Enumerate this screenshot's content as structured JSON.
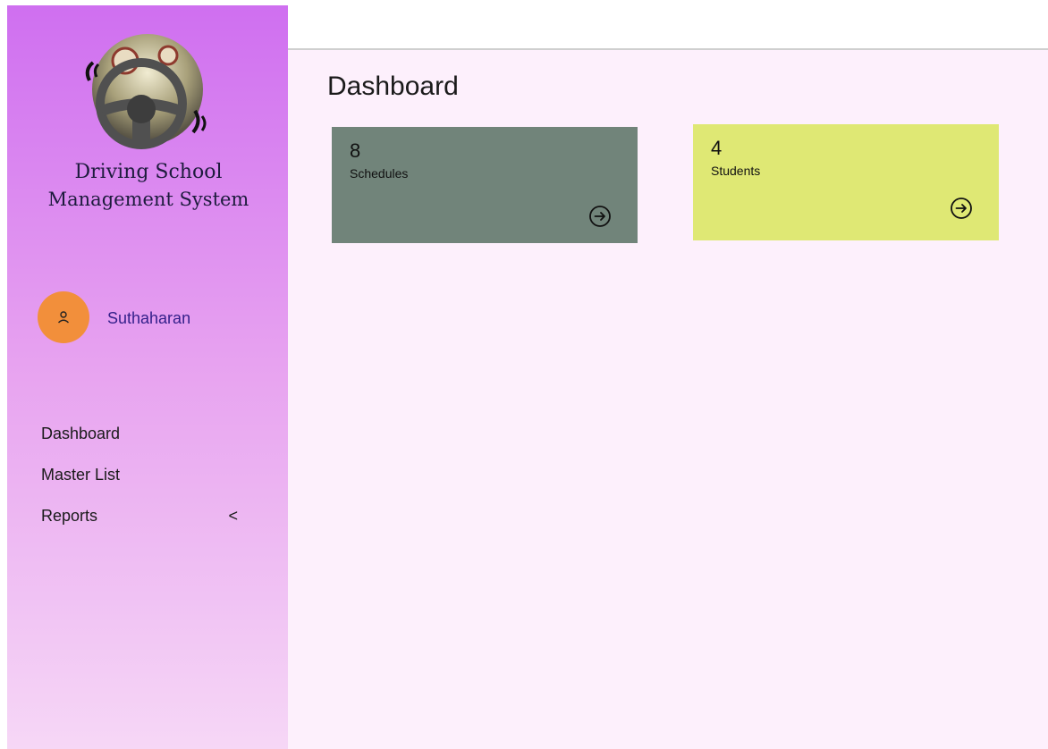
{
  "app": {
    "title_line1": "Driving School",
    "title_line2": "Management System"
  },
  "user": {
    "name": "Suthaharan"
  },
  "sidebar": {
    "items": [
      {
        "label": "Dashboard"
      },
      {
        "label": "Master List"
      },
      {
        "label": "Reports",
        "chevron": "<"
      }
    ]
  },
  "main": {
    "title": "Dashboard",
    "cards": [
      {
        "count": "8",
        "label": "Schedules",
        "color": "#71847a",
        "icon": "arrow-right-circle-icon"
      },
      {
        "count": "4",
        "label": "Students",
        "color": "#dfe874",
        "icon": "arrow-right-circle-icon"
      }
    ]
  },
  "colors": {
    "avatar": "#f28f3b",
    "username": "#34208a",
    "main_bg": "#fdf0fc"
  }
}
